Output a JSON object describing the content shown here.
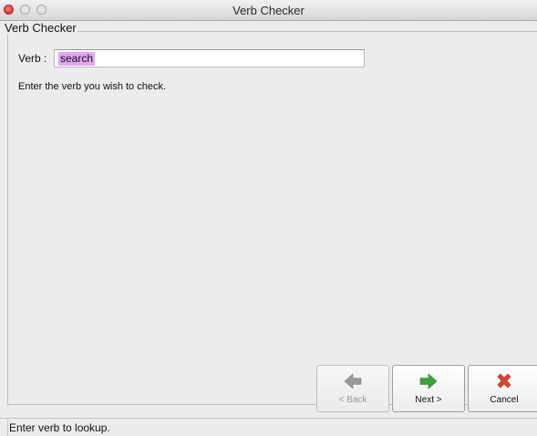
{
  "window": {
    "title": "Verb Checker"
  },
  "group": {
    "legend": "Verb Checker"
  },
  "form": {
    "verb_label": "Verb :",
    "verb_value": "search",
    "instructions": "Enter the verb you wish to check."
  },
  "buttons": {
    "back_label": "< Back",
    "next_label": "Next >",
    "cancel_label": "Cancel",
    "back_icon": "back-arrow-icon",
    "next_icon": "next-arrow-icon",
    "cancel_icon": "cancel-x-icon"
  },
  "status": {
    "text": "Enter verb to lookup."
  },
  "colors": {
    "selection": "#e3a6f3",
    "next_arrow": "#3aa53a",
    "back_arrow": "#9a9a9a",
    "cancel_x": "#d8462e",
    "close_button": "#d8332b"
  }
}
